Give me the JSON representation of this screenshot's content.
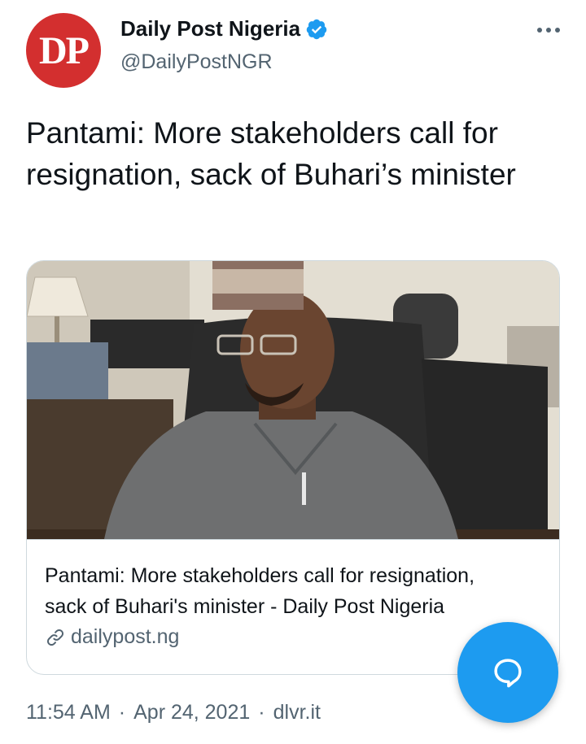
{
  "author": {
    "avatar_text": "DP",
    "display_name": "Daily Post Nigeria",
    "handle": "@DailyPostNGR",
    "verified": true
  },
  "tweet": {
    "text": "Pantami: More stakeholders call for resignation, sack of Buhari’s minister"
  },
  "card": {
    "title_line1": "Pantami: More stakeholders call for resignation,",
    "title_line2": "sack of Buhari's minister - Daily Post Nigeria",
    "domain": "dailypost.ng",
    "image_alt": "Photo of a man in a grey kaftan and cap seated at a desk in an office chair"
  },
  "meta": {
    "time": "11:54 AM",
    "separator": "·",
    "date": "Apr 24, 2021",
    "source": "dlvr.it"
  },
  "icons": {
    "more": "more-horizontal-icon",
    "verified": "verified-badge-icon",
    "link": "link-icon",
    "compose": "compose-reply-icon"
  },
  "colors": {
    "avatar_bg": "#d32f2f",
    "verified": "#1d9bf0",
    "fab": "#1d9bf0",
    "secondary_text": "#536471"
  }
}
